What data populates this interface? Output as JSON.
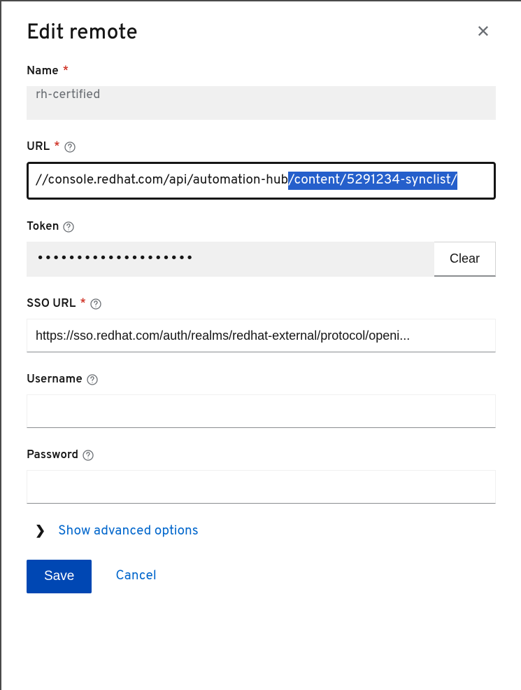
{
  "modal": {
    "title": "Edit remote"
  },
  "fields": {
    "name": {
      "label": "Name",
      "required": true,
      "value": "rh-certified"
    },
    "url": {
      "label": "URL",
      "required": true,
      "value_prefix": "//console.redhat.com/api/automation-hub",
      "value_selected": "/content/5291234-synclist/"
    },
    "token": {
      "label": "Token",
      "required": false,
      "masked_value": "••••••••••••••••••••",
      "clear_label": "Clear"
    },
    "sso_url": {
      "label": "SSO URL",
      "required": true,
      "value": "https://sso.redhat.com/auth/realms/redhat-external/protocol/openi..."
    },
    "username": {
      "label": "Username",
      "required": false,
      "value": ""
    },
    "password": {
      "label": "Password",
      "required": false,
      "value": ""
    }
  },
  "advanced": {
    "label": "Show advanced options"
  },
  "footer": {
    "save": "Save",
    "cancel": "Cancel"
  },
  "symbols": {
    "required": "*"
  }
}
